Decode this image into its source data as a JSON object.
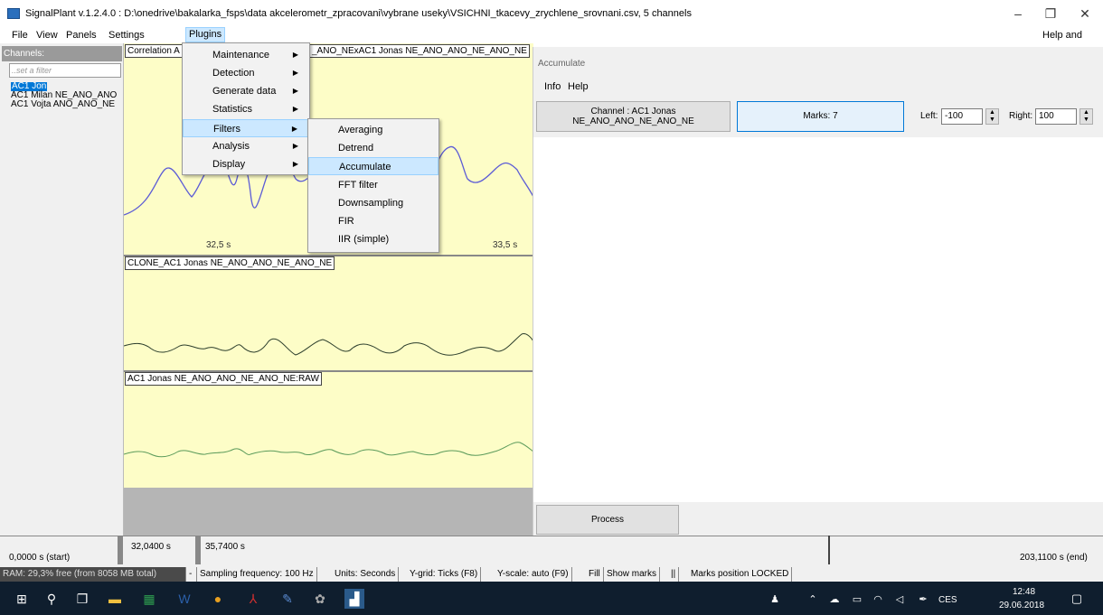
{
  "window": {
    "title": "SignalPlant v.1.2.4.0 : D:\\onedrive\\bakalarka_fsps\\data akcelerometr_zpracovani\\vybrane useky\\VSICHNI_tkacevy_zrychlene_srovnani.csv, 5 channels",
    "minimize_glyph": "–",
    "restore_glyph": "❐",
    "close_glyph": "✕"
  },
  "menubar": {
    "file": "File",
    "view": "View",
    "panels": "Panels",
    "settings": "Settings",
    "plugins": "Plugins",
    "help": "Help and info"
  },
  "sidebar": {
    "header": "Channels:",
    "filter_placeholder": "..set a filter",
    "channels": [
      "AC1 Jon",
      "AC1 Milan NE_ANO_ANO",
      "AC1 Vojta ANO_ANO_NE"
    ]
  },
  "plot": {
    "panel1_label_left": "Correlation A",
    "panel1_label_right": "_ANO_NExAC1 Jonas NE_ANO_ANO_NE_ANO_NE",
    "tick1": "32,5 s",
    "tick2": "33,5 s",
    "panel2_label": "CLONE_AC1 Jonas NE_ANO_ANO_NE_ANO_NE",
    "panel3_label": "AC1 Jonas NE_ANO_ANO_NE_ANO_NE:RAW"
  },
  "plugins_menu": {
    "items": [
      "Maintenance",
      "Detection",
      "Generate data",
      "Statistics",
      "Filters",
      "Analysis",
      "Display"
    ],
    "selected": "Filters"
  },
  "filters_submenu": {
    "items": [
      "Averaging",
      "Detrend",
      "Accumulate",
      "FFT filter",
      "Downsampling",
      "FIR",
      "IIR (simple)"
    ],
    "selected": "Accumulate"
  },
  "accumulate": {
    "title": "Accumulate",
    "menu_info": "Info",
    "menu_help": "Help",
    "channel_button": "Channel : AC1 Jonas NE_ANO_ANO_NE_ANO_NE",
    "marks_button": "Marks: 7",
    "left_label": "Left:",
    "left_value": "-100",
    "right_label": "Right:",
    "right_value": "100",
    "process_button": "Process"
  },
  "timeline": {
    "start": "0,0000 s (start)",
    "left_mark": "32,0400 s",
    "right_mark": "35,7400 s",
    "end": "203,1100 s (end)"
  },
  "statusbar": {
    "ram": "RAM: 29,3% free (from 8058 MB total)",
    "sep": "-",
    "sampling": "Sampling frequency: 100 Hz",
    "units": "Units: Seconds",
    "ygrid": "Y-grid: Ticks (F8)",
    "yscale": "Y-scale: auto (F9)",
    "fill": "Fill",
    "marks": "Show marks",
    "pipes": "||",
    "locked": "Marks position LOCKED"
  },
  "taskbar": {
    "lang": "CES",
    "time": "12:48",
    "date": "29.06.2018"
  },
  "colors": {
    "plot_bg": "#fdfdc7",
    "signal_blue": "#5b5bd6",
    "signal_dark": "#2c3e2c",
    "signal_green": "#5a9a5a",
    "menu_highlight": "#cce8ff",
    "taskbar": "#0f1e2e"
  }
}
